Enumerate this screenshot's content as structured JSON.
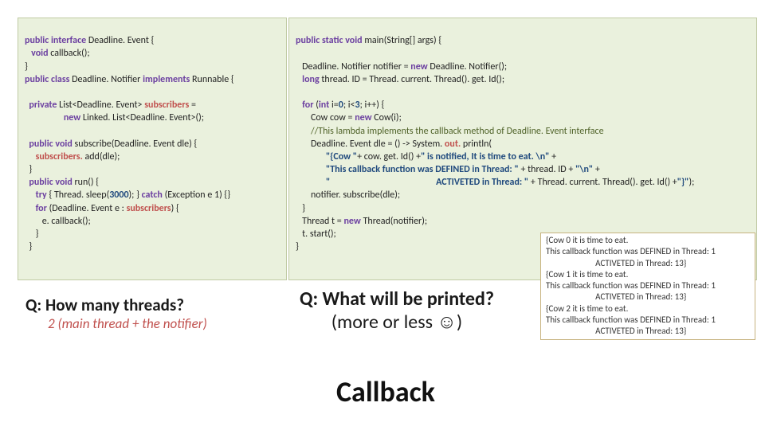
{
  "left_code": {
    "l1a": "public interface ",
    "l1b": "Deadline. Event {",
    "l2a": "   void ",
    "l2b": "callback();",
    "l3": "}",
    "l4a": "public class ",
    "l4b": "Deadline. Notifier ",
    "l4c": "implements ",
    "l4d": "Runnable ",
    "l4e": "{",
    "l5": " ",
    "l6a": "  private ",
    "l6b": "List<Deadline. Event> ",
    "l6c": "subscribers ",
    "l6d": "=",
    "l7a": "                  new ",
    "l7b": "Linked. List<Deadline. Event>();",
    "l8": " ",
    "l9a": "  public void ",
    "l9b": "subscribe(Deadline. Event dle) {",
    "l10a": "     subscribers. ",
    "l10b": "add(dle);",
    "l11": "  }",
    "l12a": "  public void ",
    "l12b": "run() {",
    "l13a": "     try ",
    "l13b": "{ Thread. sleep(",
    "l13c": "3000",
    "l13d": "); } ",
    "l13e": "catch ",
    "l13f": "(Exception e 1) {}",
    "l14a": "     for ",
    "l14b": "(Deadline. Event e : ",
    "l14c": "subscribers",
    "l14d": ") {",
    "l15": "        e. callback();",
    "l16": "     }",
    "l17": "  }"
  },
  "right_code": {
    "l1a": "public static void ",
    "l1b": "main(String[] args) {",
    "l2": " ",
    "l3a": "   Deadline. Notifier notifier = ",
    "l3b": "new ",
    "l3c": "Deadline. Notifier();",
    "l4a": "   long ",
    "l4b": "thread. ID = Thread. current. Thread(). get. Id();",
    "l5": " ",
    "l6a": "   for ",
    "l6b": "(",
    "l6c": "int ",
    "l6d": "i=",
    "l6e": "0",
    "l6f": "; i<",
    "l6g": "3",
    "l6h": "; i++) {",
    "l7a": "       Cow cow = ",
    "l7b": "new ",
    "l7c": "Cow(i);",
    "l8": "       //This lambda implements the callback method of Deadline. Event interface",
    "l9a": "       Deadline. Event dle = () -> System. ",
    "l9b": "out. ",
    "l9c": "println(",
    "l10a": "              \"{Cow \"",
    "l10b": "+ cow. get. Id() +",
    "l10c": "\" is notified, It is time to eat. \\n\" ",
    "l10d": "+",
    "l11a": "              \"This callback function was DEFINED in Thread: \" ",
    "l11b": "+ thread. ID + ",
    "l11c": "\"\\n\" ",
    "l11d": "+",
    "l12a": "              \"                       ",
    "l12b": "                          ACTIVETED in Thread: \" ",
    "l12c": "+ Thread. current. Thread(). get. Id() +",
    "l12d": "\"}\"",
    "l12e": ");",
    "l13": "       notifier. subscribe(dle);",
    "l14": "   }",
    "l15a": "   Thread t = ",
    "l15b": "new ",
    "l15c": "Thread(notifier);",
    "l16": "   t. start();",
    "l17": "}"
  },
  "q1": "Q: How many threads?",
  "a1": "2 (main thread + the notifier)",
  "q2a": "Q: What will be printed?",
  "q2b": "(more or less ☺)",
  "output": "{Cow 0 it is time to eat.\nThis callback function was DEFINED in Thread: 1\n                         ACTIVETED in Thread: 13}\n{Cow 1 it is time to eat.\nThis callback function was DEFINED in Thread: 1\n                         ACTIVETED in Thread: 13}\n{Cow 2 it is time to eat.\nThis callback function was DEFINED in Thread: 1\n                         ACTIVETED in Thread: 13}",
  "title": "Callback"
}
